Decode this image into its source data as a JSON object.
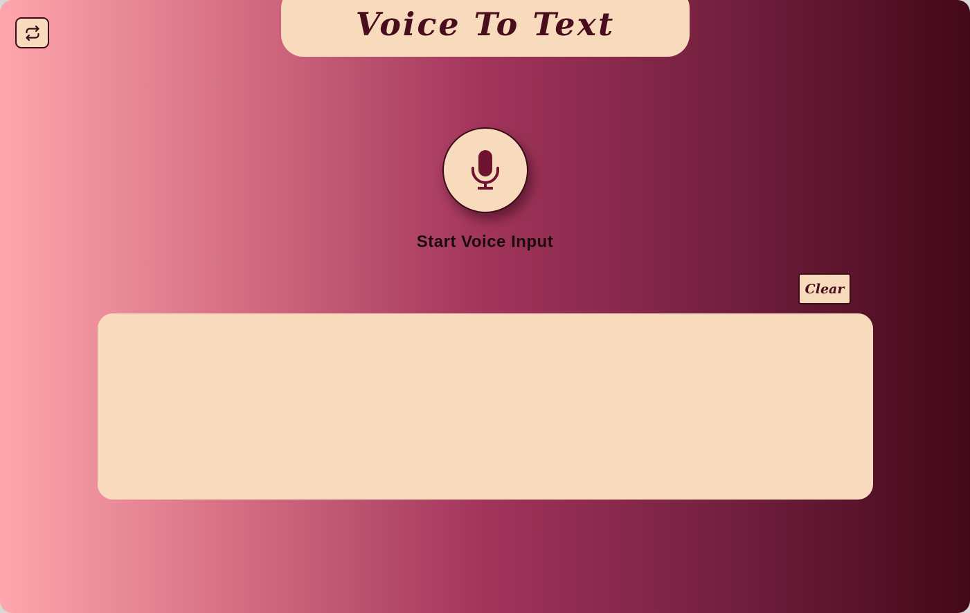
{
  "app": {
    "title": "Voice To Text"
  },
  "switch_button": {
    "icon": "repeat-arrows-icon"
  },
  "mic": {
    "icon": "microphone-icon",
    "label": "Start Voice Input"
  },
  "output": {
    "clear_label": "Clear",
    "text": "",
    "placeholder": ""
  },
  "colors": {
    "accent_cream": "#f8dbbd",
    "dark_maroon": "#4a0d1d",
    "gradient_start": "#ffa6ad",
    "gradient_mid": "#a2345b",
    "gradient_end": "#430818"
  }
}
